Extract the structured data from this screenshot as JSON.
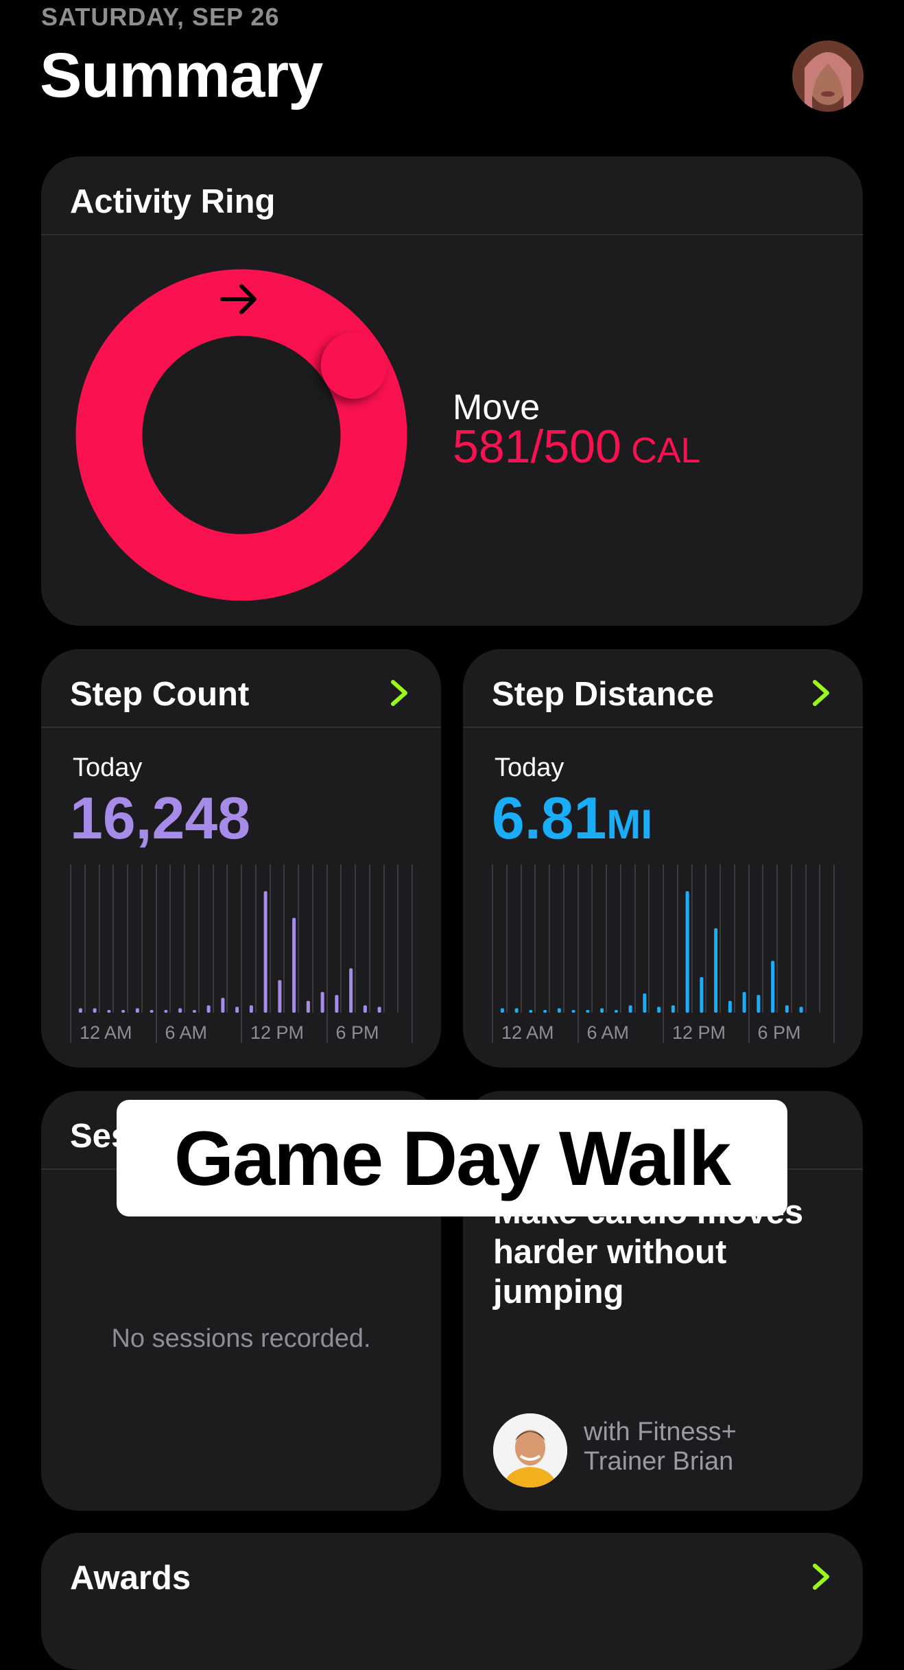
{
  "header": {
    "date": "SATURDAY, SEP 26",
    "title": "Summary"
  },
  "activity": {
    "title": "Activity Ring",
    "move_label": "Move",
    "move_value": "581/500",
    "move_unit": "CAL",
    "move_progress": 1.162,
    "ring_color": "#fa114f"
  },
  "steps": {
    "title": "Step Count",
    "period": "Today",
    "value": "16,248",
    "color": "#a68be8",
    "x_labels": [
      "12 AM",
      "6 AM",
      "12 PM",
      "6 PM"
    ]
  },
  "distance": {
    "title": "Step Distance",
    "period": "Today",
    "value": "6.81",
    "unit": "MI",
    "color": "#1aadf8",
    "x_labels": [
      "12 AM",
      "6 AM",
      "12 PM",
      "6 PM"
    ]
  },
  "hourly_relative": [
    0.03,
    0.03,
    0,
    0,
    0.03,
    0,
    0,
    0.03,
    0,
    0.05,
    0.1,
    0.04,
    0.05,
    0.82,
    0.22,
    0.64,
    0.08,
    0.14,
    0.12,
    0.3,
    0.05,
    0.04
  ],
  "distance_relative": [
    0.03,
    0.03,
    0,
    0,
    0.03,
    0,
    0,
    0.03,
    0,
    0.05,
    0.13,
    0.04,
    0.05,
    0.82,
    0.24,
    0.57,
    0.08,
    0.14,
    0.12,
    0.35,
    0.05,
    0.04
  ],
  "sessions": {
    "title": "Ses",
    "empty_text": "No sessions recorded."
  },
  "fitness": {
    "partial_line": "Make cardio moves",
    "description_line1": "harder without",
    "description_line2": "jumping",
    "trainer_line1": "with Fitness+",
    "trainer_line2": "Trainer Brian"
  },
  "awards": {
    "title": "Awards"
  },
  "overlay": {
    "text": "Game Day Walk"
  },
  "colors": {
    "accent_chevron": "#9cf81c",
    "card_bg": "#1c1c1e"
  }
}
